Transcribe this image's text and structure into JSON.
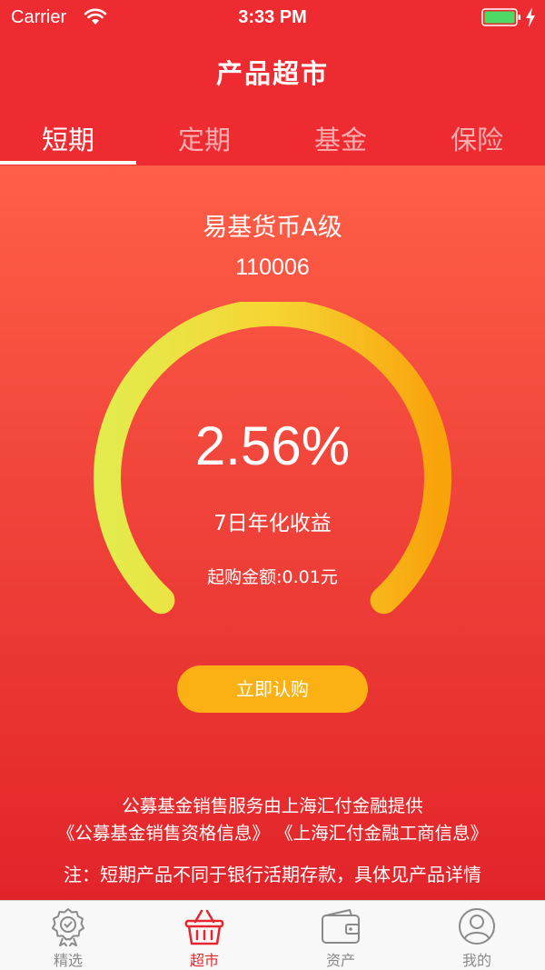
{
  "status_bar": {
    "carrier": "Carrier",
    "time": "3:33 PM",
    "battery_color": "#4cd964"
  },
  "nav": {
    "title": "产品超市"
  },
  "tabs": [
    {
      "label": "短期",
      "active": true
    },
    {
      "label": "定期",
      "active": false
    },
    {
      "label": "基金",
      "active": false
    },
    {
      "label": "保险",
      "active": false
    }
  ],
  "fund": {
    "name": "易基货币A级",
    "code": "110006",
    "rate": "2.56%",
    "rate_label": "7日年化收益",
    "min_amount": "起购金额:0.01元"
  },
  "buy_button": {
    "label": "立即认购",
    "color": "#fbb113"
  },
  "disclaimer": {
    "line1": "公募基金销售服务由上海汇付金融提供",
    "link1": "《公募基金销售资格信息》",
    "link2": "《上海汇付金融工商信息》",
    "note": "注：短期产品不同于银行活期存款，具体见产品详情"
  },
  "tabbar": [
    {
      "label": "精选",
      "icon": "badge-icon",
      "active": false
    },
    {
      "label": "超市",
      "icon": "basket-icon",
      "active": true
    },
    {
      "label": "资产",
      "icon": "wallet-icon",
      "active": false
    },
    {
      "label": "我的",
      "icon": "user-icon",
      "active": false
    }
  ],
  "colors": {
    "primary": "#ee2b31",
    "accent": "#fbb113",
    "gauge_start": "#e3ec4d",
    "gauge_end": "#f9a30b"
  }
}
